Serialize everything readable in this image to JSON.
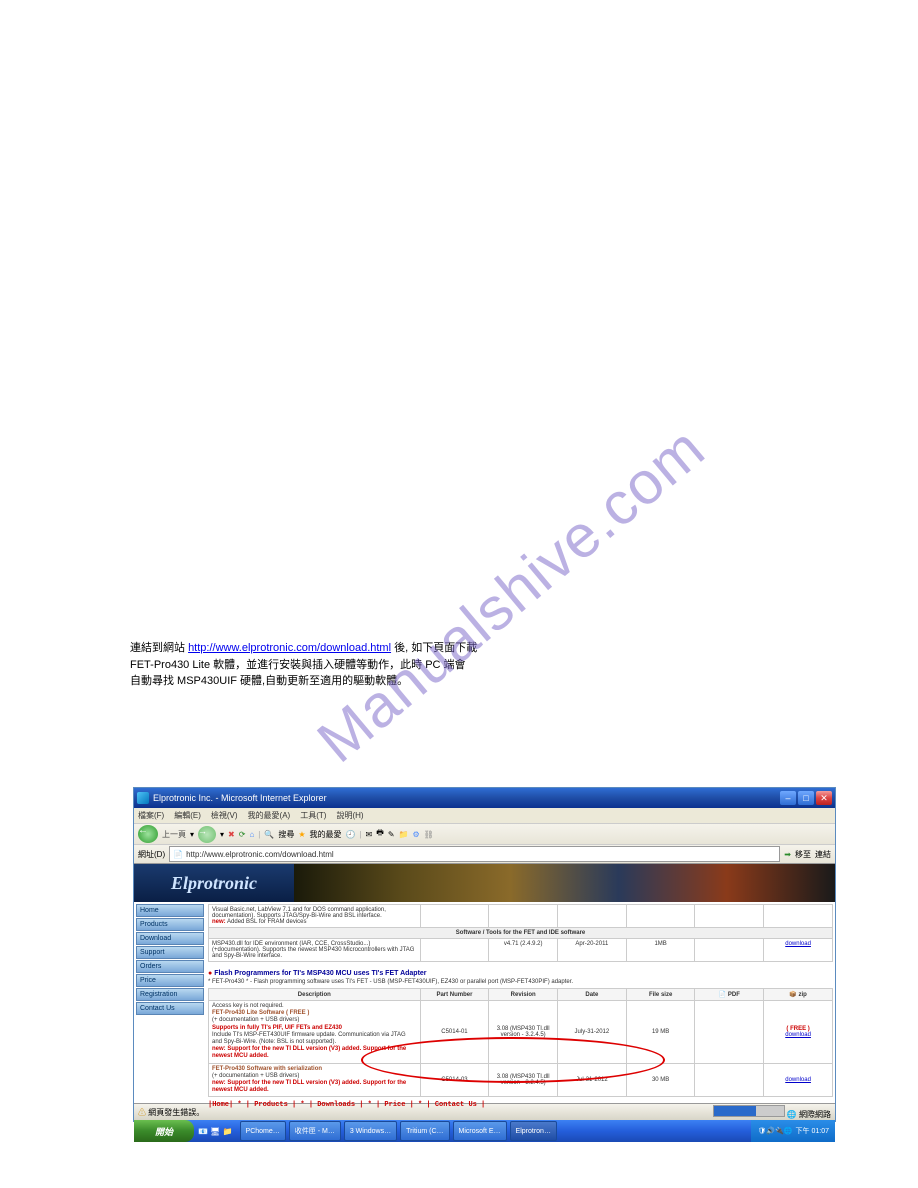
{
  "watermark": "Manualshive.com",
  "doc": {
    "link_text": "http://www.elprotronic.com/download.html",
    "para1_prefix": "連結到網站 ",
    "para1_suffix": " 後, 如下頁面下載",
    "para2": "FET-Pro430 Lite 軟體，並進行安裝與插入硬體等動作，此時 PC 端會",
    "para3": "自動尋找 MSP430UIF 硬體,自動更新至適用的驅動軟體。"
  },
  "ie": {
    "title": "Elprotronic Inc. - Microsoft Internet Explorer",
    "menu": [
      "檔案(F)",
      "編輯(E)",
      "檢視(V)",
      "我的最愛(A)",
      "工具(T)",
      "說明(H)"
    ],
    "toolbar": {
      "back": "上一頁",
      "search": "搜尋",
      "fav": "我的最愛"
    },
    "address_label": "網址(D)",
    "go_label": "移至",
    "links_label": "連結",
    "url": "http://www.elprotronic.com/download.html",
    "status": "網頁發生錯誤。"
  },
  "page": {
    "logo": "Elprotronic",
    "sidebar": [
      "Home",
      "Products",
      "Download",
      "Support",
      "Orders",
      "Price",
      "Registration",
      "Contact Us"
    ],
    "top_desc": "Visual Basic.net, LabView 7.1 and for DOS command application, documentation). Supports JTAG/Spy-Bi-Wire and BSL interface.",
    "top_new": "Added BSL for FRAM devices",
    "sw_header": "Software / Tools for the FET and IDE software",
    "sw_desc": "MSP430.dll for IDE environment (IAR, CCE, CrossStudio...) (+documentation). Supports the newest MSP430 Microcontrollers with JTAG and Spy-Bi-Wire interface.",
    "sw_rev": "v4.71 (2.4.9.2)",
    "sw_date": "Apr-20-2011",
    "sw_size": "1MB",
    "sw_link": "download",
    "section_title": "Flash Programmers for TI's MSP430 MCU uses TI's FET Adapter",
    "section_sub": "* FET-Pro430 * - Flash programming software uses TI's FET - USB (MSP-FET430UIF), EZ430 or parallel port (MSP-FET430PIF) adapter.",
    "table": {
      "headers": [
        "Description",
        "Part Number",
        "Revision",
        "Date",
        "File size",
        "PDF",
        "zip"
      ],
      "rows": [
        {
          "desc_line1": "Access key is not required.",
          "desc_bold": "FET-Pro430 Lite Software ( FREE )",
          "desc_line2": "(+ documentation + USB drivers)",
          "desc_red": "Supports in fully TI's PIF, UIF FETs and EZ430",
          "desc_line3": "Include TI's MSP-FET430UIF firmware update. Communication via JTAG and Spy-Bi-Wire. (Note: BSL is not supported).",
          "desc_new": "new: Support for the new TI DLL version (V3) added. Support for the newest MCU added.",
          "partnum": "C5014-01",
          "revision": "3.08 (MSP430 TI.dll version - 3.2.4.5)",
          "date": "July-31-2012",
          "size": "19 MB",
          "pdf": "",
          "zip_free": "( FREE )",
          "zip_link": "download"
        },
        {
          "desc_bold": "FET-Pro430 Software with serialization",
          "desc_line2": "(+ documentation + USB drivers)",
          "desc_new": "new: Support for the new TI DLL version (V3) added. Support for the newest MCU added.",
          "partnum": "C5014-03",
          "revision": "3.08 (MSP430 TI.dll version - 3.2.4.5)",
          "date": "Jul-31-2012",
          "size": "30 MB",
          "pdf": "",
          "zip_link": "download"
        }
      ]
    },
    "footer": "|Home|  *  | Products |  *  | Downloads |  *  | Price |  *  | Contact Us |"
  },
  "taskbar": {
    "start": "開始",
    "items": [
      "PChome…",
      "收件匣 - M…",
      "3 Windows…",
      "Tritium (C…",
      "Microsoft E…",
      "Elprotron…"
    ],
    "clock": "下午 01:07"
  }
}
